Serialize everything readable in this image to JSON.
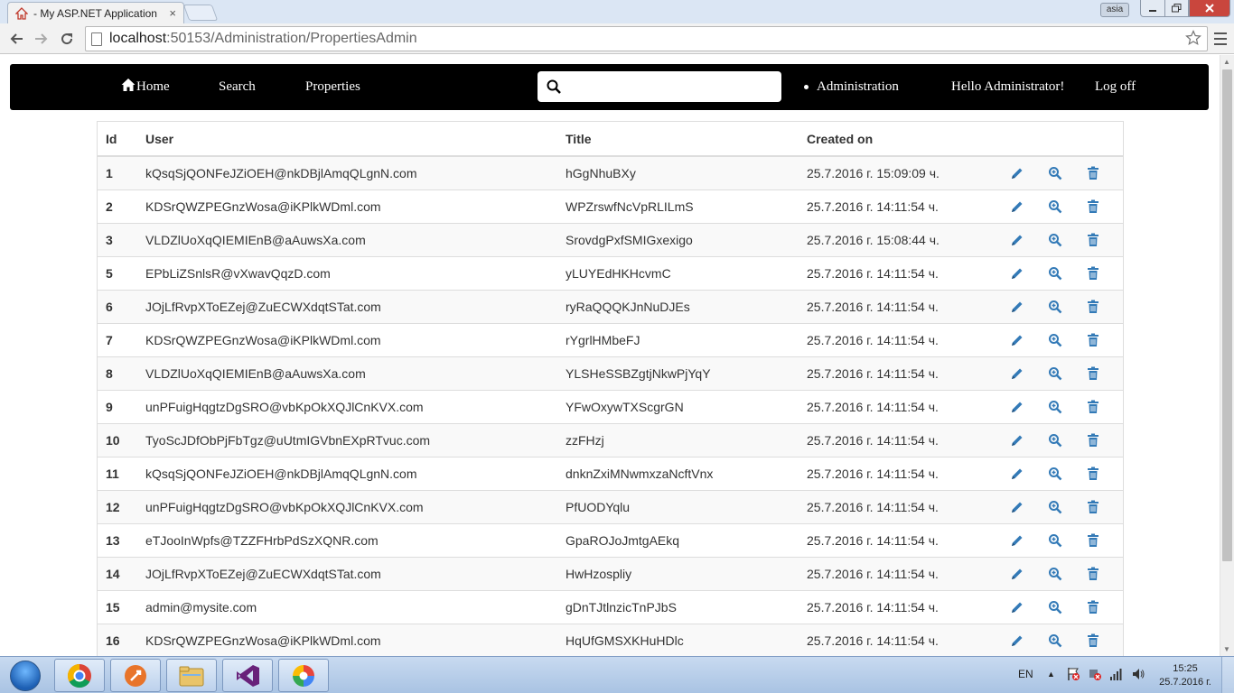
{
  "browser": {
    "tab_title": "- My ASP.NET Application",
    "tab_close": "×",
    "url_host": "localhost",
    "url_path": ":50153/Administration/PropertiesAdmin",
    "user_chip": "asia"
  },
  "nav": {
    "home": "Home",
    "search": "Search",
    "properties": "Properties",
    "search_placeholder": "",
    "administration": "Administration",
    "hello": "Hello Administrator!",
    "logoff": "Log off"
  },
  "table": {
    "headers": {
      "id": "Id",
      "user": "User",
      "title": "Title",
      "created": "Created on"
    },
    "rows": [
      {
        "id": "1",
        "user": "kQsqSjQONFeJZiOEH@nkDBjlAmqQLgnN.com",
        "title": "hGgNhuBXy",
        "created": "25.7.2016 г. 15:09:09 ч."
      },
      {
        "id": "2",
        "user": "KDSrQWZPEGnzWosa@iKPlkWDml.com",
        "title": "WPZrswfNcVpRLILmS",
        "created": "25.7.2016 г. 14:11:54 ч."
      },
      {
        "id": "3",
        "user": "VLDZlUoXqQIEMIEnB@aAuwsXa.com",
        "title": "SrovdgPxfSMIGxexigo",
        "created": "25.7.2016 г. 15:08:44 ч."
      },
      {
        "id": "5",
        "user": "EPbLiZSnlsR@vXwavQqzD.com",
        "title": "yLUYEdHKHcvmC",
        "created": "25.7.2016 г. 14:11:54 ч."
      },
      {
        "id": "6",
        "user": "JOjLfRvpXToEZej@ZuECWXdqtSTat.com",
        "title": "ryRaQQQKJnNuDJEs",
        "created": "25.7.2016 г. 14:11:54 ч."
      },
      {
        "id": "7",
        "user": "KDSrQWZPEGnzWosa@iKPlkWDml.com",
        "title": "rYgrlHMbeFJ",
        "created": "25.7.2016 г. 14:11:54 ч."
      },
      {
        "id": "8",
        "user": "VLDZlUoXqQIEMIEnB@aAuwsXa.com",
        "title": "YLSHeSSBZgtjNkwPjYqY",
        "created": "25.7.2016 г. 14:11:54 ч."
      },
      {
        "id": "9",
        "user": "unPFuigHqgtzDgSRO@vbKpOkXQJlCnKVX.com",
        "title": "YFwOxywTXScgrGN",
        "created": "25.7.2016 г. 14:11:54 ч."
      },
      {
        "id": "10",
        "user": "TyoScJDfObPjFbTgz@uUtmIGVbnEXpRTvuc.com",
        "title": "zzFHzj",
        "created": "25.7.2016 г. 14:11:54 ч."
      },
      {
        "id": "11",
        "user": "kQsqSjQONFeJZiOEH@nkDBjlAmqQLgnN.com",
        "title": "dnknZxiMNwmxzaNcftVnx",
        "created": "25.7.2016 г. 14:11:54 ч."
      },
      {
        "id": "12",
        "user": "unPFuigHqgtzDgSRO@vbKpOkXQJlCnKVX.com",
        "title": "PfUODYqlu",
        "created": "25.7.2016 г. 14:11:54 ч."
      },
      {
        "id": "13",
        "user": "eTJooInWpfs@TZZFHrbPdSzXQNR.com",
        "title": "GpaROJoJmtgAEkq",
        "created": "25.7.2016 г. 14:11:54 ч."
      },
      {
        "id": "14",
        "user": "JOjLfRvpXToEZej@ZuECWXdqtSTat.com",
        "title": "HwHzospliy",
        "created": "25.7.2016 г. 14:11:54 ч."
      },
      {
        "id": "15",
        "user": "admin@mysite.com",
        "title": "gDnTJtlnzicTnPJbS",
        "created": "25.7.2016 г. 14:11:54 ч."
      },
      {
        "id": "16",
        "user": "KDSrQWZPEGnzWosa@iKPlkWDml.com",
        "title": "HqUfGMSXKHuHDlc",
        "created": "25.7.2016 г. 14:11:54 ч."
      }
    ]
  },
  "taskbar": {
    "lang": "EN",
    "time": "15:25",
    "date": "25.7.2016 г."
  },
  "colors": {
    "nav_bg": "#000000",
    "action_icon": "#337ab7",
    "stripe": "#f9f9f9"
  }
}
